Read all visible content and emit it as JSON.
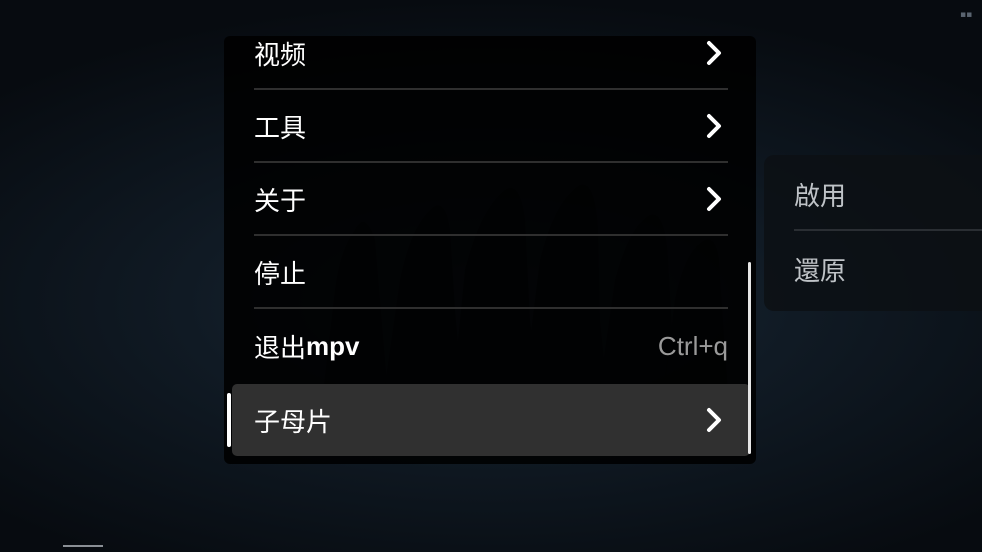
{
  "menu": {
    "items": [
      {
        "label": "视频",
        "has_submenu": true
      },
      {
        "label": "工具",
        "has_submenu": true
      },
      {
        "label": "关于",
        "has_submenu": true
      },
      {
        "label": "停止",
        "has_submenu": false
      },
      {
        "label_cjk": "退出",
        "label_latin": "mpv",
        "shortcut": "Ctrl+q",
        "has_submenu": false
      },
      {
        "label": "子母片",
        "has_submenu": true,
        "selected": true
      }
    ]
  },
  "submenu": {
    "items": [
      {
        "label": "啟用"
      },
      {
        "label": "還原"
      }
    ]
  },
  "colors": {
    "menu_background": "#000000",
    "selected_background": "#303030",
    "text": "#ffffff",
    "shortcut_text": "#9a9a9a",
    "submenu_text": "#bfc3c7"
  },
  "icons": {
    "submenu_indicator": "chevron-right-icon"
  }
}
